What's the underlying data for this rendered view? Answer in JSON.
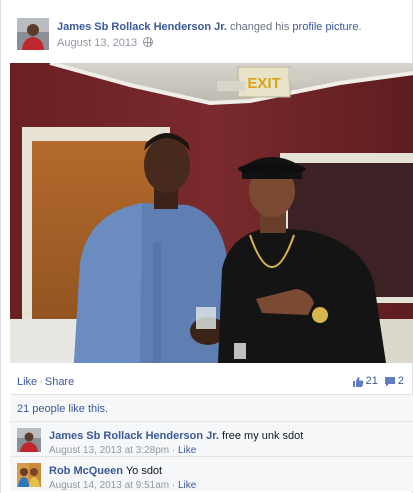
{
  "post": {
    "author": "James Sb Rollack Henderson Jr.",
    "action_text": "changed his",
    "action_link": "profile picture",
    "action_end": ".",
    "date": "August 13, 2013",
    "privacy_icon": "globe-icon"
  },
  "photo": {
    "exit_sign": "EXIT",
    "wall_color": "#6e2424",
    "ceiling_color": "#e8e6df"
  },
  "actions": {
    "like": "Like",
    "separator": "·",
    "share": "Share",
    "like_count": "21",
    "comment_count": "2",
    "like_icon": "thumbs-up-icon",
    "comment_icon": "comment-bubble-icon"
  },
  "likes_summary": "21 people like this.",
  "comments": [
    {
      "author": "James Sb Rollack Henderson Jr.",
      "text": "free my unk sdot",
      "time": "August 13, 2013 at 3:28pm",
      "separator": "·",
      "like": "Like"
    },
    {
      "author": "Rob McQueen",
      "text": "Yo sdot",
      "time": "August 14, 2013 at 9:51am",
      "separator": "·",
      "like": "Like"
    }
  ],
  "colors": {
    "link": "#3b5998",
    "muted": "#9197a3",
    "panel": "#f6f7f9"
  }
}
